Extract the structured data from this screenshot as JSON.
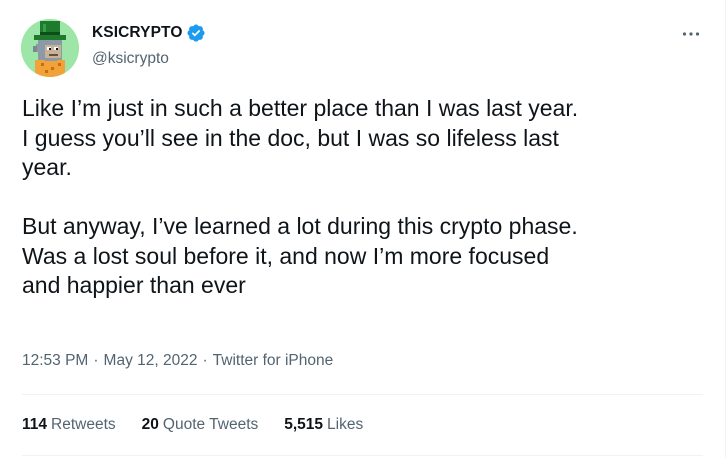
{
  "author": {
    "display_name": "KSICRYPTO",
    "handle": "@ksicrypto",
    "verified": true,
    "avatar_icon": "pixel-ape-with-green-top-hat-icon"
  },
  "tweet": {
    "text": "Like I’m just in such a better place than I was last year.\nI guess you’ll see in the doc, but I was so lifeless last\nyear.\n\nBut anyway, I’ve learned a lot during this crypto phase.\nWas a lost soul before it, and now I’m more focused\nand happier than ever"
  },
  "meta": {
    "time": "12:53 PM",
    "separator": "·",
    "date": "May 12, 2022",
    "source": "Twitter for iPhone"
  },
  "stats": {
    "retweets_count": "114",
    "retweets_label": "Retweets",
    "quotes_count": "20",
    "quotes_label": "Quote Tweets",
    "likes_count": "5,515",
    "likes_label": "Likes"
  },
  "colors": {
    "text_primary": "#0f1419",
    "text_secondary": "#536471",
    "verified_blue": "#1d9bf0",
    "divider": "#eff3f4",
    "avatar_bg": "#9ee6a8"
  }
}
